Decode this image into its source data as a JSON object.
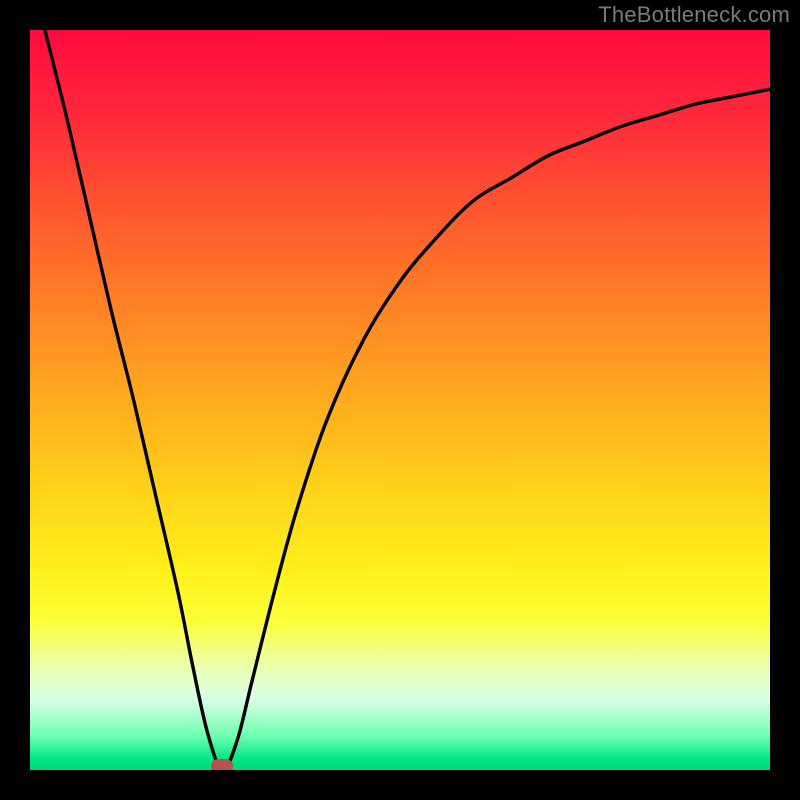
{
  "watermark": "TheBottleneck.com",
  "chart_data": {
    "type": "line",
    "title": "",
    "xlabel": "",
    "ylabel": "",
    "xlim": [
      0,
      100
    ],
    "ylim": [
      0,
      100
    ],
    "grid": false,
    "series": [
      {
        "name": "bottleneck-curve",
        "x": [
          2,
          5,
          8,
          11,
          14,
          17,
          20,
          22,
          24,
          26,
          28,
          30,
          33,
          36,
          40,
          45,
          50,
          55,
          60,
          65,
          70,
          75,
          80,
          85,
          90,
          95,
          100
        ],
        "y": [
          100,
          88,
          75,
          62,
          50,
          37,
          24,
          14,
          5,
          0,
          4,
          12,
          24,
          35,
          47,
          58,
          66,
          72,
          77,
          80,
          83,
          85,
          87,
          88.5,
          90,
          91,
          92
        ]
      }
    ],
    "marker": {
      "x": 26,
      "y": 0
    },
    "background_gradient": {
      "stops": [
        {
          "pos": 0.0,
          "color": "#ff0a3f"
        },
        {
          "pos": 0.12,
          "color": "#ff2a3a"
        },
        {
          "pos": 0.3,
          "color": "#ff6a2a"
        },
        {
          "pos": 0.48,
          "color": "#ffa51f"
        },
        {
          "pos": 0.62,
          "color": "#ffd21a"
        },
        {
          "pos": 0.73,
          "color": "#fff01a"
        },
        {
          "pos": 0.8,
          "color": "#fcff3a"
        },
        {
          "pos": 0.86,
          "color": "#ecffae"
        },
        {
          "pos": 0.905,
          "color": "#d7ffe6"
        },
        {
          "pos": 0.955,
          "color": "#6bffaf"
        },
        {
          "pos": 0.985,
          "color": "#00e884"
        },
        {
          "pos": 1.0,
          "color": "#00d877"
        }
      ]
    }
  }
}
